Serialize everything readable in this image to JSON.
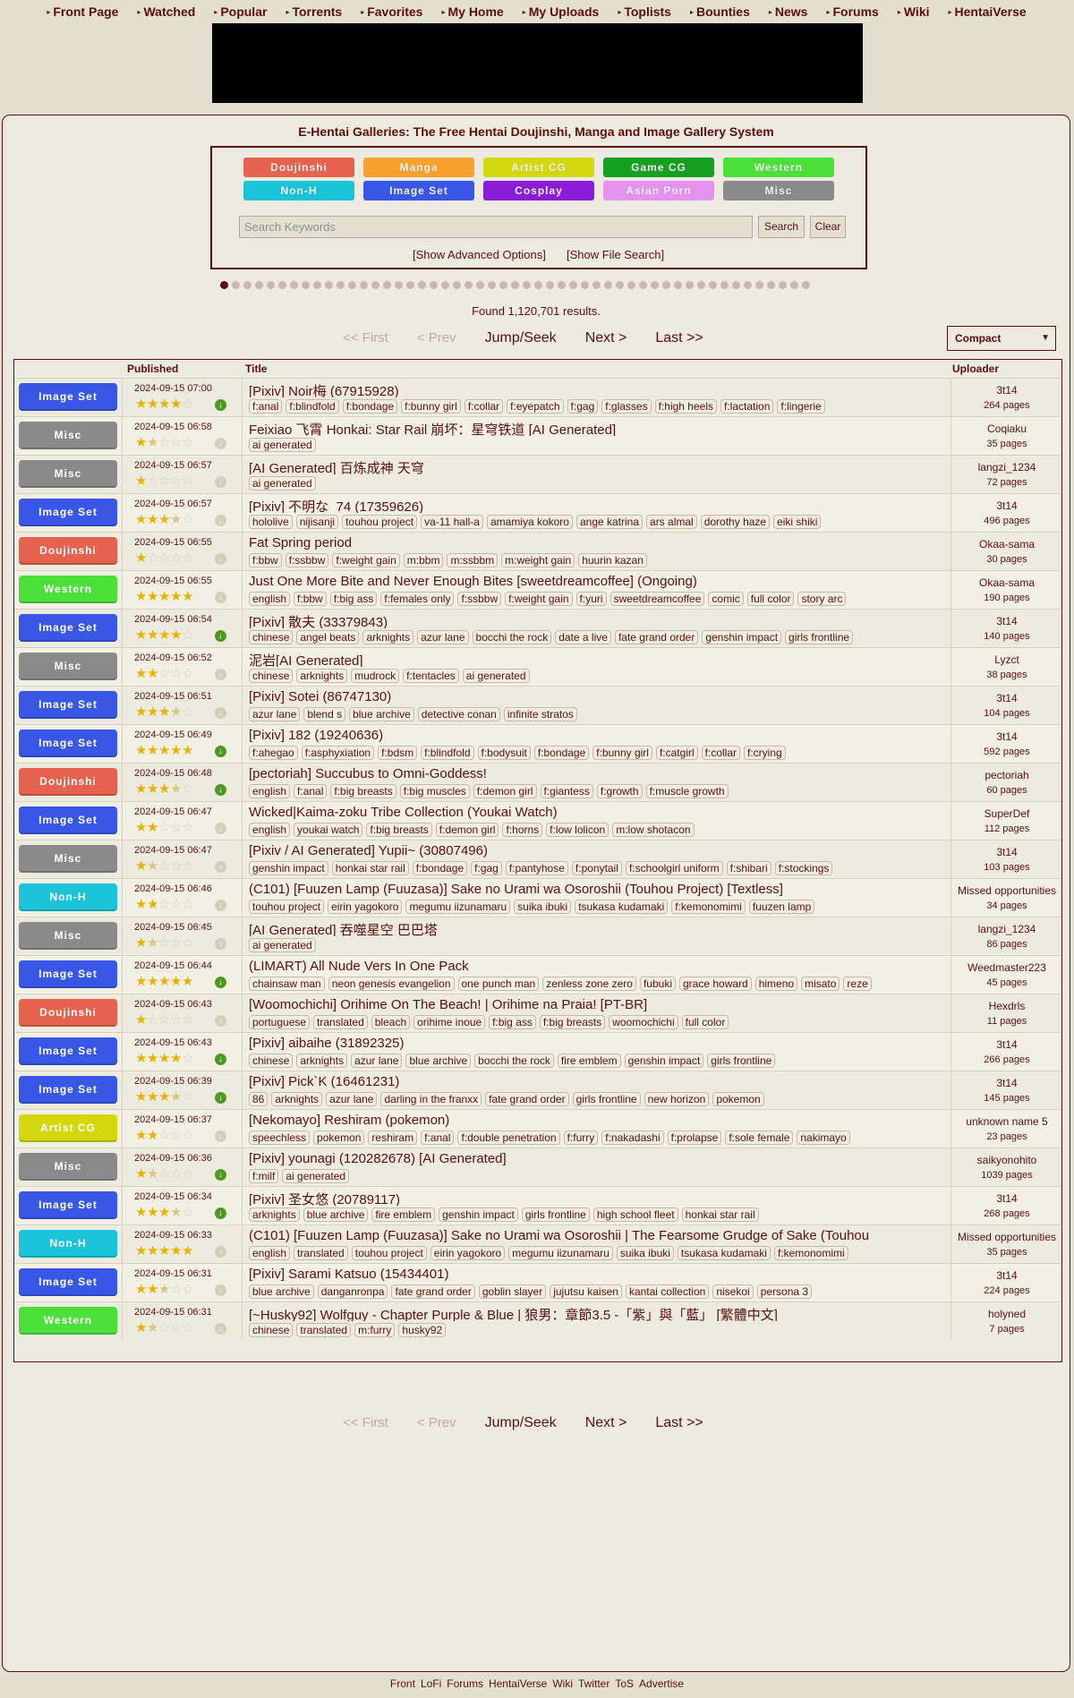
{
  "nav": [
    "Front Page",
    "Watched",
    "Popular",
    "Torrents",
    "Favorites",
    "My Home",
    "My Uploads",
    "Toplists",
    "Bounties",
    "News",
    "Forums",
    "Wiki",
    "HentaiVerse"
  ],
  "headline": "E-Hentai Galleries: The Free Hentai Doujinshi, Manga and Image Gallery System",
  "categories": [
    {
      "label": "Doujinshi",
      "color": "#E6624E"
    },
    {
      "label": "Manga",
      "color": "#F5A12C"
    },
    {
      "label": "Artist CG",
      "color": "#D4D80F"
    },
    {
      "label": "Game CG",
      "color": "#15A021"
    },
    {
      "label": "Western",
      "color": "#4BE039"
    },
    {
      "label": "Non-H",
      "color": "#1BC3D8"
    },
    {
      "label": "Image Set",
      "color": "#3957E6"
    },
    {
      "label": "Cosplay",
      "color": "#8C1BD8"
    },
    {
      "label": "Asian Porn",
      "color": "#E592EF"
    },
    {
      "label": "Misc",
      "color": "#8A8A8A"
    }
  ],
  "search": {
    "placeholder": "Search Keywords",
    "search_label": "Search",
    "clear_label": "Clear",
    "advanced": "[Show Advanced Options]",
    "file_search": "[Show File Search]"
  },
  "found": "Found 1,120,701 results.",
  "pager": {
    "first": "<< First",
    "prev": "< Prev",
    "jump": "Jump/Seek",
    "next": "Next >",
    "last": "Last >>"
  },
  "display_mode": "Compact",
  "columns": {
    "published": "Published",
    "title": "Title",
    "uploader": "Uploader"
  },
  "rows": [
    {
      "cat": "Image Set",
      "color": "#3957E6",
      "date": "2024-09-15 07:00",
      "rating": 4,
      "torrent": true,
      "title": "[Pixiv] Noir梅 (67915928)",
      "tags": [
        "f:anal",
        "f:blindfold",
        "f:bondage",
        "f:bunny girl",
        "f:collar",
        "f:eyepatch",
        "f:gag",
        "f:glasses",
        "f:high heels",
        "f:lactation",
        "f:lingerie"
      ],
      "uploader": "3t14",
      "pages": "264 pages"
    },
    {
      "cat": "Misc",
      "color": "#8A8A8A",
      "date": "2024-09-15 06:58",
      "rating": 1.5,
      "torrent": false,
      "title": "Feixiao 飞霄 Honkai: Star Rail 崩坏：星穹铁道 [AI Generated]",
      "tags": [
        "ai generated"
      ],
      "uploader": "Coqiaku",
      "pages": "35 pages"
    },
    {
      "cat": "Misc",
      "color": "#8A8A8A",
      "date": "2024-09-15 06:57",
      "rating": 1,
      "torrent": false,
      "title": "[AI Generated] 百炼成神 天穹",
      "tags": [
        "ai generated"
      ],
      "uploader": "langzi_1234",
      "pages": "72 pages"
    },
    {
      "cat": "Image Set",
      "color": "#3957E6",
      "date": "2024-09-15 06:57",
      "rating": 3.5,
      "torrent": false,
      "title": "[Pixiv] 不明な_74 (17359626)",
      "tags": [
        "hololive",
        "nijisanji",
        "touhou project",
        "va-11 hall-a",
        "amamiya kokoro",
        "ange katrina",
        "ars almal",
        "dorothy haze",
        "eiki shiki"
      ],
      "uploader": "3t14",
      "pages": "496 pages"
    },
    {
      "cat": "Doujinshi",
      "color": "#E6624E",
      "date": "2024-09-15 06:55",
      "rating": 1,
      "torrent": false,
      "title": "Fat Spring period",
      "tags": [
        "f:bbw",
        "f:ssbbw",
        "f:weight gain",
        "m:bbm",
        "m:ssbbm",
        "m:weight gain",
        "huurin kazan"
      ],
      "uploader": "Okaa-sama",
      "pages": "30 pages"
    },
    {
      "cat": "Western",
      "color": "#4BE039",
      "date": "2024-09-15 06:55",
      "rating": 5,
      "torrent": false,
      "title": "Just One More Bite and Never Enough Bites [sweetdreamcoffee] (Ongoing)",
      "tags": [
        "english",
        "f:bbw",
        "f:big ass",
        "f:females only",
        "f:ssbbw",
        "f:weight gain",
        "f:yuri",
        "sweetdreamcoffee",
        "comic",
        "full color",
        "story arc"
      ],
      "uploader": "Okaa-sama",
      "pages": "190 pages"
    },
    {
      "cat": "Image Set",
      "color": "#3957E6",
      "date": "2024-09-15 06:54",
      "rating": 4,
      "torrent": true,
      "title": "[Pixiv] 散夫 (33379843)",
      "tags": [
        "chinese",
        "angel beats",
        "arknights",
        "azur lane",
        "bocchi the rock",
        "date a live",
        "fate grand order",
        "genshin impact",
        "girls frontline"
      ],
      "uploader": "3t14",
      "pages": "140 pages"
    },
    {
      "cat": "Misc",
      "color": "#8A8A8A",
      "date": "2024-09-15 06:52",
      "rating": 2,
      "torrent": false,
      "title": "泥岩[AI Generated]",
      "tags": [
        "chinese",
        "arknights",
        "mudrock",
        "f:tentacles",
        "ai generated"
      ],
      "uploader": "Lyzct",
      "pages": "38 pages"
    },
    {
      "cat": "Image Set",
      "color": "#3957E6",
      "date": "2024-09-15 06:51",
      "rating": 3.5,
      "torrent": false,
      "title": "[Pixiv] Sotei (86747130)",
      "tags": [
        "azur lane",
        "blend s",
        "blue archive",
        "detective conan",
        "infinite stratos"
      ],
      "uploader": "3t14",
      "pages": "104 pages"
    },
    {
      "cat": "Image Set",
      "color": "#3957E6",
      "date": "2024-09-15 06:49",
      "rating": 5,
      "torrent": true,
      "title": "[Pixiv] 182 (19240636)",
      "tags": [
        "f:ahegao",
        "f:asphyxiation",
        "f:bdsm",
        "f:blindfold",
        "f:bodysuit",
        "f:bondage",
        "f:bunny girl",
        "f:catgirl",
        "f:collar",
        "f:crying"
      ],
      "uploader": "3t14",
      "pages": "592 pages"
    },
    {
      "cat": "Doujinshi",
      "color": "#E6624E",
      "date": "2024-09-15 06:48",
      "rating": 3.5,
      "torrent": true,
      "title": "[pectoriah] Succubus to Omni-Goddess!",
      "tags": [
        "english",
        "f:anal",
        "f:big breasts",
        "f:big muscles",
        "f:demon girl",
        "f:giantess",
        "f:growth",
        "f:muscle growth"
      ],
      "uploader": "pectoriah",
      "pages": "60 pages"
    },
    {
      "cat": "Image Set",
      "color": "#3957E6",
      "date": "2024-09-15 06:47",
      "rating": 2,
      "torrent": false,
      "title": "Wicked|Kaima-zoku Tribe Collection (Youkai Watch)",
      "tags": [
        "english",
        "youkai watch",
        "f:big breasts",
        "f:demon girl",
        "f:horns",
        "f:low lolicon",
        "m:low shotacon"
      ],
      "uploader": "SuperDef",
      "pages": "112 pages"
    },
    {
      "cat": "Misc",
      "color": "#8A8A8A",
      "date": "2024-09-15 06:47",
      "rating": 1.5,
      "torrent": false,
      "title": "[Pixiv / AI Generated] Yupii~ (30807496)",
      "tags": [
        "genshin impact",
        "honkai star rail",
        "f:bondage",
        "f:gag",
        "f:pantyhose",
        "f:ponytail",
        "f:schoolgirl uniform",
        "f:shibari",
        "f:stockings"
      ],
      "uploader": "3t14",
      "pages": "103 pages"
    },
    {
      "cat": "Non-H",
      "color": "#1BC3D8",
      "date": "2024-09-15 06:46",
      "rating": 2,
      "torrent": false,
      "title": "(C101) [Fuuzen Lamp (Fuuzasa)] Sake no Urami wa Osoroshii (Touhou Project) [Textless]",
      "tags": [
        "touhou project",
        "eirin yagokoro",
        "megumu iizunamaru",
        "suika ibuki",
        "tsukasa kudamaki",
        "f:kemonomimi",
        "fuuzen lamp"
      ],
      "uploader": "Missed opportunities",
      "pages": "34 pages"
    },
    {
      "cat": "Misc",
      "color": "#8A8A8A",
      "date": "2024-09-15 06:45",
      "rating": 1.5,
      "torrent": false,
      "title": "[AI Generated] 吞噬星空 巴巴塔",
      "tags": [
        "ai generated"
      ],
      "uploader": "langzi_1234",
      "pages": "86 pages"
    },
    {
      "cat": "Image Set",
      "color": "#3957E6",
      "date": "2024-09-15 06:44",
      "rating": 5,
      "torrent": true,
      "title": "(LIMART) All Nude Vers In One Pack",
      "tags": [
        "chainsaw man",
        "neon genesis evangelion",
        "one punch man",
        "zenless zone zero",
        "fubuki",
        "grace howard",
        "himeno",
        "misato",
        "reze"
      ],
      "uploader": "Weedmaster223",
      "pages": "45 pages"
    },
    {
      "cat": "Doujinshi",
      "color": "#E6624E",
      "date": "2024-09-15 06:43",
      "rating": 1,
      "torrent": false,
      "title": "[Woomochichi] Orihime On The Beach! | Orihime na Praia! [PT-BR]",
      "tags": [
        "portuguese",
        "translated",
        "bleach",
        "orihime inoue",
        "f:big ass",
        "f:big breasts",
        "woomochichi",
        "full color"
      ],
      "uploader": "Hexdrls",
      "pages": "11 pages"
    },
    {
      "cat": "Image Set",
      "color": "#3957E6",
      "date": "2024-09-15 06:43",
      "rating": 4,
      "torrent": true,
      "title": "[Pixiv] aibaihe (31892325)",
      "tags": [
        "chinese",
        "arknights",
        "azur lane",
        "blue archive",
        "bocchi the rock",
        "fire emblem",
        "genshin impact",
        "girls frontline"
      ],
      "uploader": "3t14",
      "pages": "266 pages"
    },
    {
      "cat": "Image Set",
      "color": "#3957E6",
      "date": "2024-09-15 06:39",
      "rating": 3.5,
      "torrent": true,
      "title": "[Pixiv] Pick`K (16461231)",
      "tags": [
        "86",
        "arknights",
        "azur lane",
        "darling in the franxx",
        "fate grand order",
        "girls frontline",
        "new horizon",
        "pokemon"
      ],
      "uploader": "3t14",
      "pages": "145 pages"
    },
    {
      "cat": "Artist CG",
      "color": "#D4D80F",
      "date": "2024-09-15 06:37",
      "rating": 2,
      "torrent": false,
      "title": "[Nekomayo] Reshiram (pokemon)",
      "tags": [
        "speechless",
        "pokemon",
        "reshiram",
        "f:anal",
        "f:double penetration",
        "f:furry",
        "f:nakadashi",
        "f:prolapse",
        "f:sole female",
        "nakimayo"
      ],
      "uploader": "unknown name 5",
      "pages": "23 pages"
    },
    {
      "cat": "Misc",
      "color": "#8A8A8A",
      "date": "2024-09-15 06:36",
      "rating": 1.5,
      "torrent": true,
      "title": "[Pixiv] younagi (120282678) [AI Generated]",
      "tags": [
        "f:milf",
        "ai generated"
      ],
      "uploader": "saikyonohito",
      "pages": "1039 pages"
    },
    {
      "cat": "Image Set",
      "color": "#3957E6",
      "date": "2024-09-15 06:34",
      "rating": 3.5,
      "torrent": true,
      "title": "[Pixiv] 圣女悠 (20789117)",
      "tags": [
        "arknights",
        "blue archive",
        "fire emblem",
        "genshin impact",
        "girls frontline",
        "high school fleet",
        "honkai star rail"
      ],
      "uploader": "3t14",
      "pages": "268 pages"
    },
    {
      "cat": "Non-H",
      "color": "#1BC3D8",
      "date": "2024-09-15 06:33",
      "rating": 5,
      "torrent": false,
      "title": "(C101) [Fuuzen Lamp (Fuuzasa)] Sake no Urami wa Osoroshii | The Fearsome Grudge of Sake (Touhou",
      "tags": [
        "english",
        "translated",
        "touhou project",
        "eirin yagokoro",
        "megumu iizunamaru",
        "suika ibuki",
        "tsukasa kudamaki",
        "f:kemonomimi"
      ],
      "uploader": "Missed opportunities",
      "pages": "35 pages"
    },
    {
      "cat": "Image Set",
      "color": "#3957E6",
      "date": "2024-09-15 06:31",
      "rating": 2.5,
      "torrent": false,
      "title": "[Pixiv] Sarami Katsuo (15434401)",
      "tags": [
        "blue archive",
        "danganronpa",
        "fate grand order",
        "goblin slayer",
        "jujutsu kaisen",
        "kantai collection",
        "nisekoi",
        "persona 3"
      ],
      "uploader": "3t14",
      "pages": "224 pages"
    },
    {
      "cat": "Western",
      "color": "#4BE039",
      "date": "2024-09-15 06:31",
      "rating": 1.5,
      "torrent": false,
      "title": "[~Husky92] Wolfguy - Chapter Purple & Blue | 狼男：章節3.5 -「紫」與「藍」 [繁體中文]",
      "tags": [
        "chinese",
        "translated",
        "m:furry",
        "husky92"
      ],
      "uploader": "holyned",
      "pages": "7 pages"
    }
  ],
  "footer": [
    "Front",
    "LoFi",
    "Forums",
    "HentaiVerse",
    "Wiki",
    "Twitter",
    "ToS",
    "Advertise"
  ]
}
